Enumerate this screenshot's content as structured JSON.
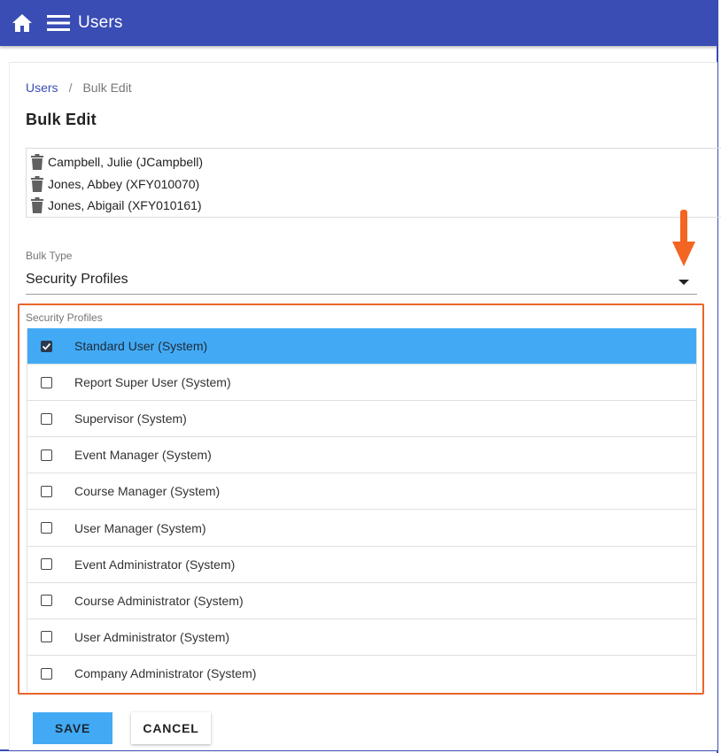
{
  "appbar": {
    "title": "Users",
    "color": "#3a4db5",
    "home_icon": "home-icon",
    "menu_icon": "hamburger-menu-icon"
  },
  "breadcrumb": {
    "items": [
      "Users",
      "Bulk Edit"
    ],
    "separator": "/"
  },
  "page": {
    "title": "Bulk Edit"
  },
  "selected_users": [
    "Campbell, Julie (JCampbell)",
    "Jones, Abbey (XFY010070)",
    "Jones, Abigail (XFY010161)"
  ],
  "bulk_type": {
    "label": "Bulk Type",
    "value": "Security Profiles"
  },
  "security_profiles": {
    "label": "Security Profiles",
    "selected_color": "#42aaf5",
    "items": [
      {
        "label": "Standard User (System)",
        "checked": true
      },
      {
        "label": "Report Super User (System)",
        "checked": false
      },
      {
        "label": "Supervisor (System)",
        "checked": false
      },
      {
        "label": "Event Manager (System)",
        "checked": false
      },
      {
        "label": "Course Manager (System)",
        "checked": false
      },
      {
        "label": "User Manager (System)",
        "checked": false
      },
      {
        "label": "Event Administrator (System)",
        "checked": false
      },
      {
        "label": "Course Administrator (System)",
        "checked": false
      },
      {
        "label": "User Administrator (System)",
        "checked": false
      },
      {
        "label": "Company Administrator (System)",
        "checked": false
      }
    ]
  },
  "actions": {
    "save_label": "SAVE",
    "cancel_label": "CANCEL"
  },
  "annotation": {
    "highlight_color": "#e8662a"
  }
}
